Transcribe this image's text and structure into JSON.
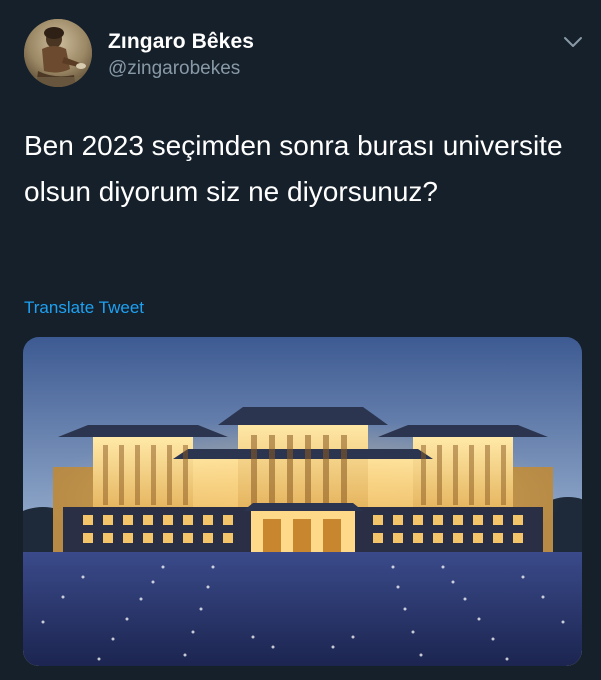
{
  "user": {
    "display_name": "Zıngaro Bêkes",
    "handle": "@zingarobekes",
    "avatar_icon": "profile-avatar"
  },
  "menu": {
    "icon": "chevron-down-icon"
  },
  "tweet": {
    "text": "Ben 2023 seçimden sonra burası universite olsun diyorum siz ne diyorsunuz?",
    "translate_label": "Translate Tweet"
  },
  "media": {
    "description_icon": "palace-photo"
  },
  "colors": {
    "background": "#15202b",
    "link": "#1da1f2",
    "secondary_text": "#8899a6",
    "primary_text": "#ffffff"
  }
}
